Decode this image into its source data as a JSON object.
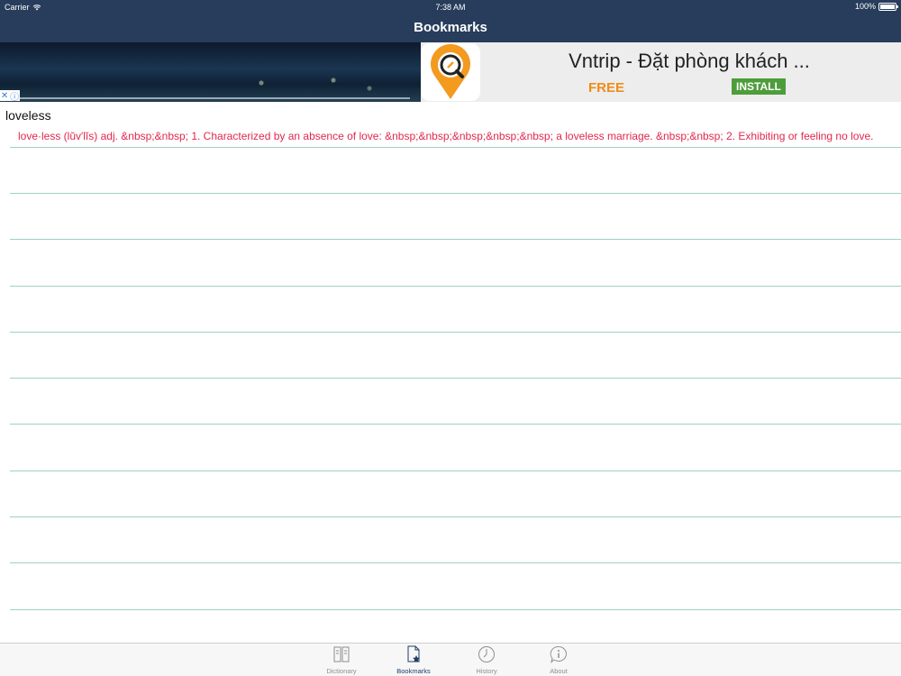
{
  "status_bar": {
    "carrier": "Carrier",
    "time": "7:38 AM",
    "battery": "100%",
    "battery_level": 1.0
  },
  "nav": {
    "title": "Bookmarks"
  },
  "ad": {
    "headline": "Vntrip - Đặt phòng khách ...",
    "price_label": "FREE",
    "install_label": "INSTALL",
    "close_symbol": "✕",
    "info_symbol": "ⓘ",
    "colors": {
      "free": "#f08c17",
      "install_bg": "#4e9d3b",
      "logo_orange": "#f39a1f"
    }
  },
  "bookmarks": [
    {
      "word": "loveless",
      "definition": "love·less   (lŭv′lĭs) adj.  &nbsp;&nbsp; 1.  Characterized by an absence of love: &nbsp;&nbsp;&nbsp;&nbsp;&nbsp;  a loveless marriage.   &nbsp;&nbsp; 2.  Exhibiting or feeling no love."
    }
  ],
  "tabs": [
    {
      "label": "Dictionary",
      "icon": "dictionary-icon",
      "active": false
    },
    {
      "label": "Bookmarks",
      "icon": "bookmarks-icon",
      "active": true
    },
    {
      "label": "History",
      "icon": "history-icon",
      "active": false
    },
    {
      "label": "About",
      "icon": "about-icon",
      "active": false
    }
  ],
  "colors": {
    "nav_bg": "#273d5b",
    "separator": "#9fd0c8",
    "definition": "#e0284c",
    "tab_active": "#1e3c66",
    "tab_inactive": "#8e8e93"
  }
}
